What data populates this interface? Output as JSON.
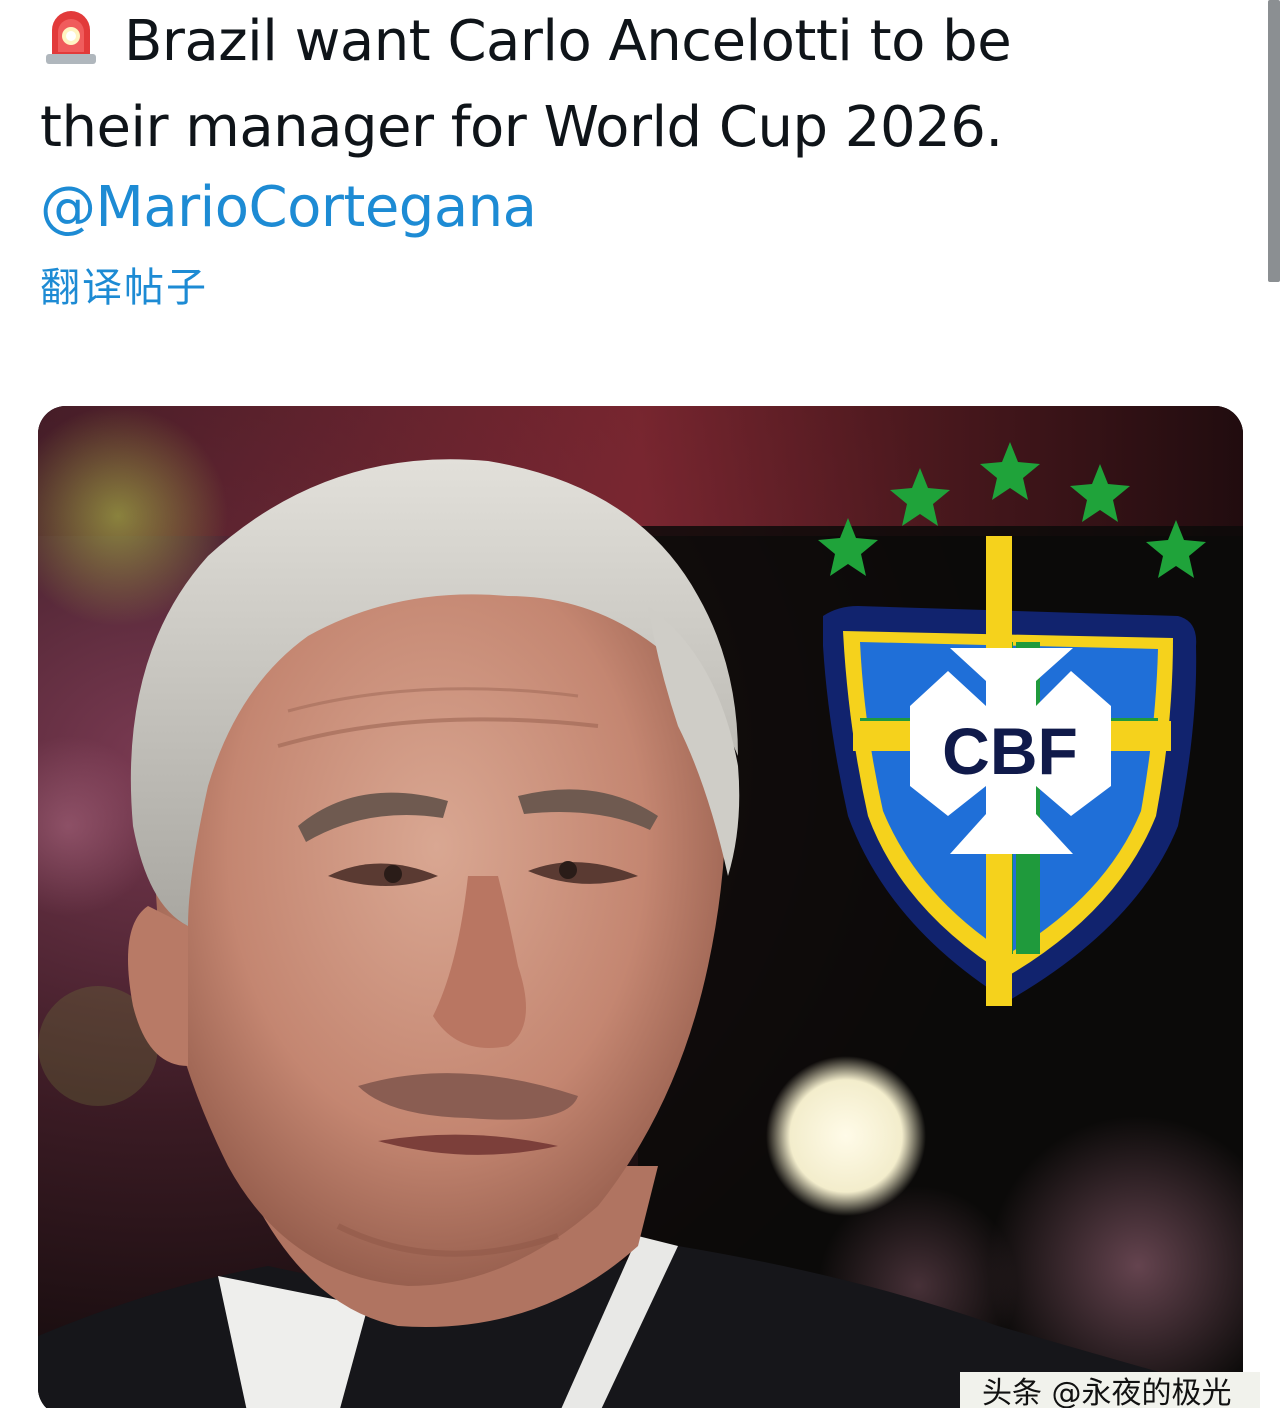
{
  "tweet": {
    "siren_icon": "rotating-light-icon",
    "text": "Brazil want Carlo Ancelotti to be their manager for World Cup 2026.",
    "mention": "@MarioCortegana",
    "translate_link": "翻译帖子"
  },
  "media": {
    "crest_text": "CBF",
    "crest_stars": 5
  },
  "watermark": {
    "text": "头条 @永夜的极光"
  },
  "colors": {
    "link": "#1d8bd4",
    "text": "#0f1419",
    "crest_blue": "#1f6fd8",
    "crest_yellow": "#f5d21c",
    "crest_green": "#1f9a3c"
  }
}
